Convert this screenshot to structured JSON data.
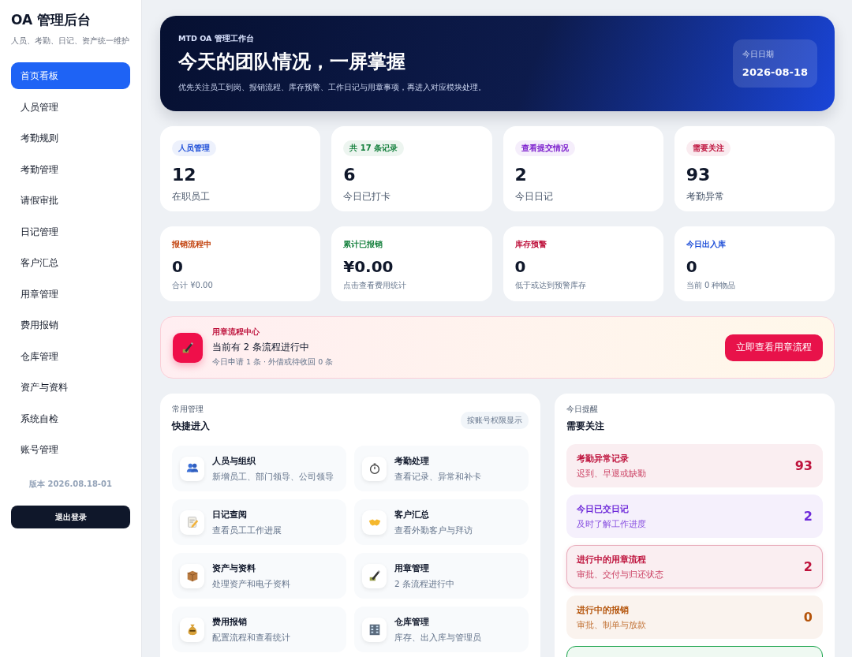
{
  "sidebar": {
    "title": "OA 管理后台",
    "subtitle": "人员、考勤、日记、资产统一维护",
    "items": [
      {
        "label": "首页看板",
        "selected": true
      },
      {
        "label": "人员管理",
        "selected": false
      },
      {
        "label": "考勤规则",
        "selected": false
      },
      {
        "label": "考勤管理",
        "selected": false
      },
      {
        "label": "请假审批",
        "selected": false
      },
      {
        "label": "日记管理",
        "selected": false
      },
      {
        "label": "客户汇总",
        "selected": false
      },
      {
        "label": "用章管理",
        "selected": false
      },
      {
        "label": "费用报销",
        "selected": false
      },
      {
        "label": "仓库管理",
        "selected": false
      },
      {
        "label": "资产与资料",
        "selected": false
      },
      {
        "label": "系统自检",
        "selected": false
      },
      {
        "label": "账号管理",
        "selected": false
      }
    ],
    "version": "版本 2026.08.18-01",
    "logout": "退出登录"
  },
  "hero": {
    "eyebrow": "MTD OA 管理工作台",
    "title": "今天的团队情况，一屏掌握",
    "description": "优先关注员工到岗、报销流程、库存预警、工作日记与用章事项，再进入对应模块处理。",
    "date_label": "今日日期",
    "date": "2026-08-18"
  },
  "stats": [
    {
      "tag": "人员管理",
      "color": "#1d4ed8",
      "value": "12",
      "label": "在职员工"
    },
    {
      "tag": "共 17 条记录",
      "color": "#15803d",
      "value": "6",
      "label": "今日已打卡"
    },
    {
      "tag": "查看提交情况",
      "color": "#7e22ce",
      "value": "2",
      "label": "今日日记"
    },
    {
      "tag": "需要关注",
      "color": "#be123c",
      "value": "93",
      "label": "考勤异常"
    }
  ],
  "metrics": [
    {
      "title": "报销流程中",
      "color": "#c2410c",
      "value": "0",
      "note": "合计 ¥0.00"
    },
    {
      "title": "累计已报销",
      "color": "#15803d",
      "value": "¥0.00",
      "note": "点击查看费用统计"
    },
    {
      "title": "库存预警",
      "color": "#be123c",
      "value": "0",
      "note": "低于或达到预警库存"
    },
    {
      "title": "今日出入库",
      "color": "#1d4ed8",
      "value": "0",
      "note": "当前 0 种物品"
    }
  ],
  "seal_banner": {
    "eyebrow": "用章流程中心",
    "title": "当前有 2 条流程进行中",
    "detail": "今日申请 1 条 · 外借或待收回 0 条",
    "button": "立即查看用章流程"
  },
  "quick_access": {
    "eyebrow": "常用管理",
    "title": "快捷进入",
    "badge": "按账号权限显示",
    "items": [
      {
        "kind": "people",
        "title": "人员与组织",
        "subtitle": "新增员工、部门领导、公司领导"
      },
      {
        "kind": "stopwatch",
        "title": "考勤处理",
        "subtitle": "查看记录、异常和补卡"
      },
      {
        "kind": "memo",
        "title": "日记查阅",
        "subtitle": "查看员工工作进展"
      },
      {
        "kind": "handshake",
        "title": "客户汇总",
        "subtitle": "查看外勤客户与拜访"
      },
      {
        "kind": "box",
        "title": "资产与资料",
        "subtitle": "处理资产和电子资料"
      },
      {
        "kind": "pen",
        "title": "用章管理",
        "subtitle": "2 条流程进行中"
      },
      {
        "kind": "moneybag",
        "title": "费用报销",
        "subtitle": "配置流程和查看统计"
      },
      {
        "kind": "building",
        "title": "仓库管理",
        "subtitle": "库存、出入库与管理员"
      }
    ]
  },
  "reminders": {
    "eyebrow": "今日提醒",
    "title": "需要关注",
    "items": [
      {
        "title": "考勤异常记录",
        "subtitle": "迟到、早退或缺勤",
        "count": "93",
        "color": "#be123c",
        "highlighted": false
      },
      {
        "title": "今日已交日记",
        "subtitle": "及时了解工作进度",
        "count": "2",
        "color": "#6d28d9",
        "highlighted": false
      },
      {
        "title": "进行中的用章流程",
        "subtitle": "审批、交付与归还状态",
        "count": "2",
        "color": "#be123c",
        "highlighted": true
      },
      {
        "title": "进行中的报销",
        "subtitle": "审批、制单与放款",
        "count": "0",
        "color": "#b45309",
        "highlighted": false
      },
      {
        "color": "#16a34a",
        "highlighted": false
      }
    ]
  }
}
